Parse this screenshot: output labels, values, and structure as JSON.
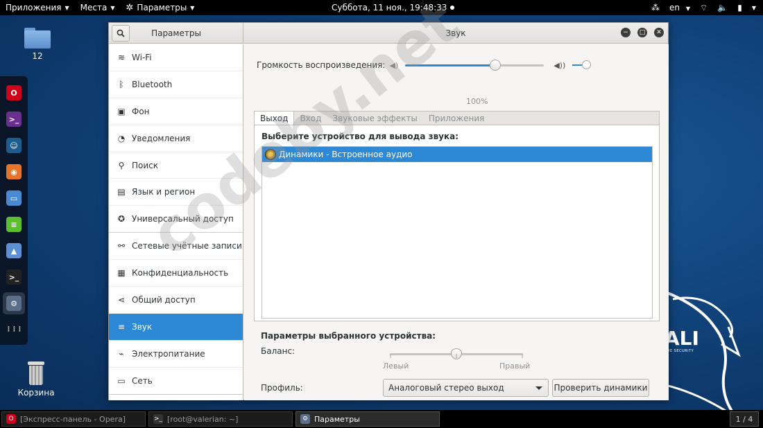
{
  "topbar": {
    "apps_menu": "Приложения",
    "places_menu": "Места",
    "settings_menu": "Параметры",
    "clock": "Суббота, 11 ноя., 19:48:33",
    "language": "en"
  },
  "desktop": {
    "folder_label": "12",
    "trash_label": "Корзина",
    "watermark": "codeby.net",
    "kali_text": "ALI",
    "kali_sub": "VE SECURITY"
  },
  "dock": {
    "items": [
      {
        "name": "opera",
        "color": "#d0021b",
        "glyph": "O"
      },
      {
        "name": "terminal-purple",
        "color": "#6b2f8f",
        "glyph": ">_"
      },
      {
        "name": "avatar-app",
        "color": "#1b5d8f",
        "glyph": "☺"
      },
      {
        "name": "firefox",
        "color": "#e8742a",
        "glyph": "◉"
      },
      {
        "name": "files",
        "color": "#4a8ad2",
        "glyph": "▭"
      },
      {
        "name": "text-editor",
        "color": "#5cbd2e",
        "glyph": "≡"
      },
      {
        "name": "image-viewer",
        "color": "#5f8fd3",
        "glyph": "▲"
      },
      {
        "name": "terminal",
        "color": "#222222",
        "glyph": ">_"
      },
      {
        "name": "settings",
        "color": "#5c6f8a",
        "glyph": "⚙"
      },
      {
        "name": "app-grid",
        "color": "transparent",
        "glyph": "⋮⋮⋮"
      }
    ]
  },
  "window": {
    "sidebar_title": "Параметры",
    "title": "Звук"
  },
  "sidebar": {
    "items": [
      {
        "label": "Wi-Fi",
        "icon": "wifi-icon",
        "glyph": "≋"
      },
      {
        "label": "Bluetooth",
        "icon": "bluetooth-icon",
        "glyph": "ᛒ"
      },
      {
        "label": "Фон",
        "icon": "background-icon",
        "glyph": "▣"
      },
      {
        "label": "Уведомления",
        "icon": "notifications-icon",
        "glyph": "◔"
      },
      {
        "label": "Поиск",
        "icon": "search-icon",
        "glyph": "⚲"
      },
      {
        "label": "Язык и регион",
        "icon": "language-icon",
        "glyph": "▤"
      },
      {
        "label": "Универсальный доступ",
        "icon": "accessibility-icon",
        "glyph": "✪"
      },
      {
        "label": "Сетевые учётные записи",
        "icon": "online-accounts-icon",
        "glyph": "⚯"
      },
      {
        "label": "Конфиденциальность",
        "icon": "privacy-icon",
        "glyph": "▦"
      },
      {
        "label": "Общий доступ",
        "icon": "sharing-icon",
        "glyph": "⋖"
      },
      {
        "label": "Звук",
        "icon": "sound-icon",
        "glyph": "≡"
      },
      {
        "label": "Электропитание",
        "icon": "power-icon",
        "glyph": "⌁"
      },
      {
        "label": "Сеть",
        "icon": "network-icon",
        "glyph": "▭"
      }
    ],
    "selected_index": 10
  },
  "sound": {
    "volume_label": "Громкость воспроизведения:",
    "volume_percent_text": "100%",
    "volume_level": 0.65,
    "tabs": [
      "Выход",
      "Вход",
      "Звуковые эффекты",
      "Приложения"
    ],
    "active_tab": 0,
    "output_heading": "Выберите устройство для вывода звука:",
    "devices": [
      "Динамики - Встроенное аудио"
    ],
    "device_params_heading": "Параметры выбранного устройства:",
    "balance_label": "Баланс:",
    "balance_left": "Левый",
    "balance_right": "Правый",
    "balance_level": 0.5,
    "profile_label": "Профиль:",
    "profile_value": "Аналоговый стерео выход",
    "test_button": "Проверить динамики"
  },
  "taskbar": {
    "tasks": [
      {
        "label": "[Экспресс-панель - Opera]",
        "color": "#d0021b",
        "glyph": "O"
      },
      {
        "label": "[root@valerian: ~]",
        "color": "#333333",
        "glyph": ">_"
      },
      {
        "label": "Параметры",
        "color": "#5c6f8a",
        "glyph": "⚙"
      }
    ],
    "workspace": "1 / 4"
  },
  "colors": {
    "accent": "#2d89d6",
    "topbar_bg": "#000000"
  }
}
